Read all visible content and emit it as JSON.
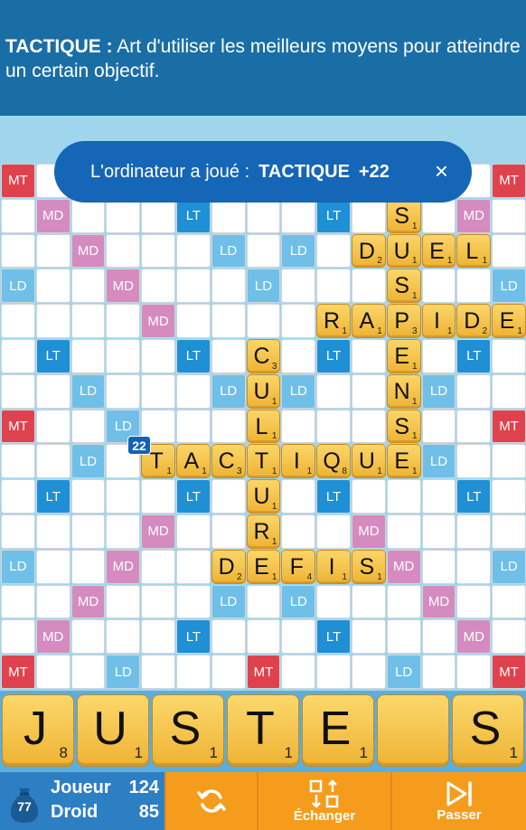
{
  "definition": {
    "word": "TACTIQUE :",
    "text": " Art d'utiliser les meilleurs moyens pour atteindre un certain objectif."
  },
  "toast": {
    "prefix": "L'ordinateur a joué :",
    "word": "TACTIQUE",
    "points": "+22",
    "close": "×"
  },
  "board": {
    "labels": {
      "MT": "MT",
      "MD": "MD",
      "LT": "LT",
      "LD": "LD"
    },
    "premiums": [
      "MT . . LD . . . MT . . . LD . . MT",
      ". MD . . . LT . . . LT . . . MD .",
      ". . MD . . . LD . LD . . . MD . .",
      "LD . . MD . . . LD . . . MD . . LD",
      ". . . . MD . . . . . MD . . . .",
      ". LT . . . LT . . . LT . . . LT .",
      ". . LD . . . LD . LD . . . LD . .",
      "MT . . LD . . . MD . . . LD . . MT",
      ". . LD . . . LD . LD . . . LD . .",
      ". LT . . . LT . . . LT . . . LT .",
      ". . . . MD . . . . . MD . . . .",
      "LD . . MD . . . LD . . . MD . . LD",
      ". . MD . . . LD . LD . . . MD . .",
      ". MD . . . LT . . . LT . . . MD .",
      "MT . . LD . . . MT . . . LD . . MT"
    ],
    "tiles": [
      {
        "r": 1,
        "c": 11,
        "l": "S",
        "v": "1"
      },
      {
        "r": 2,
        "c": 10,
        "l": "D",
        "v": "2"
      },
      {
        "r": 2,
        "c": 11,
        "l": "U",
        "v": "1"
      },
      {
        "r": 2,
        "c": 12,
        "l": "E",
        "v": "1"
      },
      {
        "r": 2,
        "c": 13,
        "l": "L",
        "v": "1"
      },
      {
        "r": 3,
        "c": 11,
        "l": "S",
        "v": "1"
      },
      {
        "r": 4,
        "c": 9,
        "l": "R",
        "v": "1"
      },
      {
        "r": 4,
        "c": 10,
        "l": "A",
        "v": "1"
      },
      {
        "r": 4,
        "c": 11,
        "l": "P",
        "v": "3"
      },
      {
        "r": 4,
        "c": 12,
        "l": "I",
        "v": "1"
      },
      {
        "r": 4,
        "c": 13,
        "l": "D",
        "v": "2"
      },
      {
        "r": 4,
        "c": 14,
        "l": "E",
        "v": "1"
      },
      {
        "r": 5,
        "c": 7,
        "l": "C",
        "v": "3"
      },
      {
        "r": 5,
        "c": 11,
        "l": "E",
        "v": "1"
      },
      {
        "r": 6,
        "c": 7,
        "l": "U",
        "v": "1"
      },
      {
        "r": 6,
        "c": 11,
        "l": "N",
        "v": "1"
      },
      {
        "r": 7,
        "c": 7,
        "l": "L",
        "v": "1"
      },
      {
        "r": 7,
        "c": 11,
        "l": "S",
        "v": "1"
      },
      {
        "r": 8,
        "c": 4,
        "l": "T",
        "v": "1"
      },
      {
        "r": 8,
        "c": 5,
        "l": "A",
        "v": "1"
      },
      {
        "r": 8,
        "c": 6,
        "l": "C",
        "v": "3"
      },
      {
        "r": 8,
        "c": 7,
        "l": "T",
        "v": "1"
      },
      {
        "r": 8,
        "c": 8,
        "l": "I",
        "v": "1"
      },
      {
        "r": 8,
        "c": 9,
        "l": "Q",
        "v": "8"
      },
      {
        "r": 8,
        "c": 10,
        "l": "U",
        "v": "1"
      },
      {
        "r": 8,
        "c": 11,
        "l": "E",
        "v": "1"
      },
      {
        "r": 9,
        "c": 7,
        "l": "U",
        "v": "1"
      },
      {
        "r": 10,
        "c": 7,
        "l": "R",
        "v": "1"
      },
      {
        "r": 11,
        "c": 6,
        "l": "D",
        "v": "2"
      },
      {
        "r": 11,
        "c": 7,
        "l": "E",
        "v": "1"
      },
      {
        "r": 11,
        "c": 8,
        "l": "F",
        "v": "4"
      },
      {
        "r": 11,
        "c": 9,
        "l": "I",
        "v": "1"
      },
      {
        "r": 11,
        "c": 10,
        "l": "S",
        "v": "1"
      }
    ],
    "score_badge": "22"
  },
  "rack": [
    {
      "l": "J",
      "v": "8"
    },
    {
      "l": "U",
      "v": "1"
    },
    {
      "l": "S",
      "v": "1"
    },
    {
      "l": "T",
      "v": "1"
    },
    {
      "l": "E",
      "v": "1"
    },
    {
      "l": "",
      "v": ""
    },
    {
      "l": "S",
      "v": "1"
    }
  ],
  "scores": {
    "bag_count": "77",
    "player_label": "Joueur",
    "player_score": "124",
    "bot_label": "Droid",
    "bot_score": "85"
  },
  "buttons": {
    "shuffle_icon": "refresh-icon",
    "exchange_label": "Échanger",
    "pass_label": "Passer"
  },
  "colors": {
    "MT": "#e0424d",
    "MD": "#d58bbf",
    "LT": "#1f8fd6",
    "LD": "#6fbfe9",
    "header": "#1a6ea6",
    "action": "#f59c1c"
  }
}
